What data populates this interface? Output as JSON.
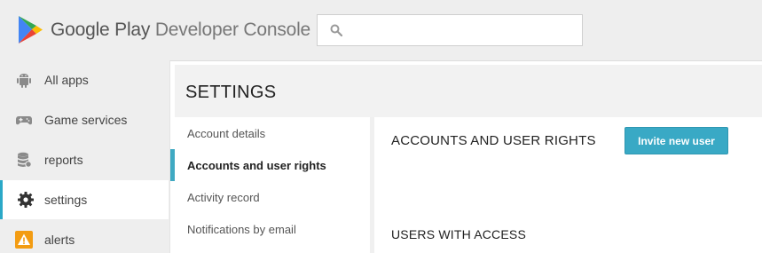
{
  "header": {
    "brand_google_play": "Google Play",
    "brand_rest": " Developer Console",
    "search": {
      "placeholder": "",
      "value": "",
      "icon": "search-icon"
    }
  },
  "nav": {
    "items": [
      {
        "label": "All apps",
        "icon": "android-icon",
        "active": false
      },
      {
        "label": "Game services",
        "icon": "gamepad-icon",
        "active": false
      },
      {
        "label": "reports",
        "icon": "database-icon",
        "active": false
      },
      {
        "label": "settings",
        "icon": "gear-icon",
        "active": true
      },
      {
        "label": "alerts",
        "icon": "warning-icon",
        "active": false
      }
    ]
  },
  "settings": {
    "title": "SETTINGS",
    "subnav": [
      {
        "label": "Account details",
        "active": false
      },
      {
        "label": "Accounts and user rights",
        "active": true
      },
      {
        "label": "Activity record",
        "active": false
      },
      {
        "label": "Notifications by email",
        "active": false
      }
    ],
    "content": {
      "title": "ACCOUNTS AND USER RIGHTS",
      "invite_button": "Invite new user",
      "users_title": "USERS WITH ACCESS"
    }
  },
  "colors": {
    "accent": "#39a9c5",
    "alert": "#f39c12",
    "play_green": "#34a853",
    "play_blue": "#4285f4",
    "play_red": "#ea4335",
    "play_yellow": "#fbbc05"
  }
}
